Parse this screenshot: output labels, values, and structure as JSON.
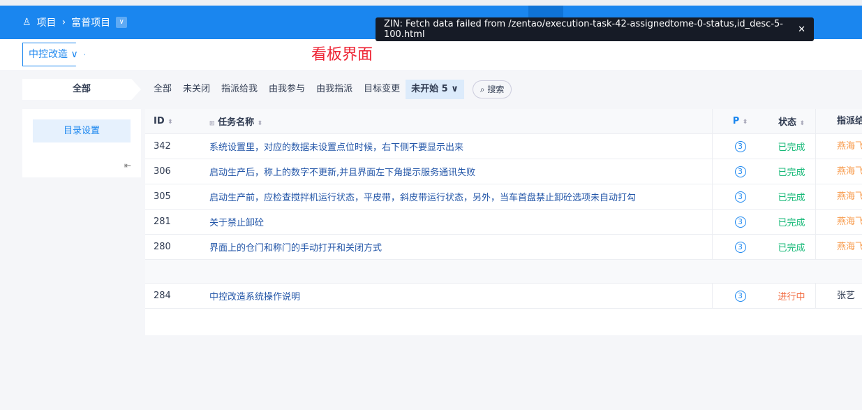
{
  "header": {
    "root": "项目",
    "project": "富普项目"
  },
  "execution": "中控改造",
  "toast": {
    "message": "ZIN: Fetch data failed from /zentao/execution-task-42-assignedtome-0-status,id_desc-5-100.html"
  },
  "annotation": "看板界面",
  "left_category": "全部",
  "tabs": [
    "全部",
    "未关闭",
    "指派给我",
    "由我参与",
    "由我指派",
    "目标变更"
  ],
  "active_tab": {
    "label": "未开始",
    "count": "5"
  },
  "search_label": "搜索",
  "sidebar": {
    "button": "目录设置"
  },
  "table": {
    "columns": [
      "ID",
      "任务名称",
      "P",
      "状态",
      "指派给"
    ],
    "rows": [
      {
        "id": "342",
        "name": "系统设置里，对应的数据未设置点位时候，右下侧不要显示出来",
        "p": "3",
        "status": "已完成",
        "assignee": "燕海飞"
      },
      {
        "id": "306",
        "name": "启动生产后，称上的数字不更新,并且界面左下角提示服务通讯失败",
        "p": "3",
        "status": "已完成",
        "assignee": "燕海飞"
      },
      {
        "id": "305",
        "name": "启动生产前，应检查搅拌机运行状态，平皮带，斜皮带运行状态，另外，当车首盘禁止卸砼选项未自动打勾",
        "p": "3",
        "status": "已完成",
        "assignee": "燕海飞"
      },
      {
        "id": "281",
        "name": "关于禁止卸砼",
        "p": "3",
        "status": "已完成",
        "assignee": "燕海飞"
      },
      {
        "id": "280",
        "name": "界面上的仓门和称门的手动打开和关闭方式",
        "p": "3",
        "status": "已完成",
        "assignee": "燕海飞"
      }
    ],
    "overlap_row": {
      "id": "284",
      "name": "中控改造系统操作说明",
      "p": "3",
      "status": "进行中",
      "assignee": "张艺"
    }
  }
}
